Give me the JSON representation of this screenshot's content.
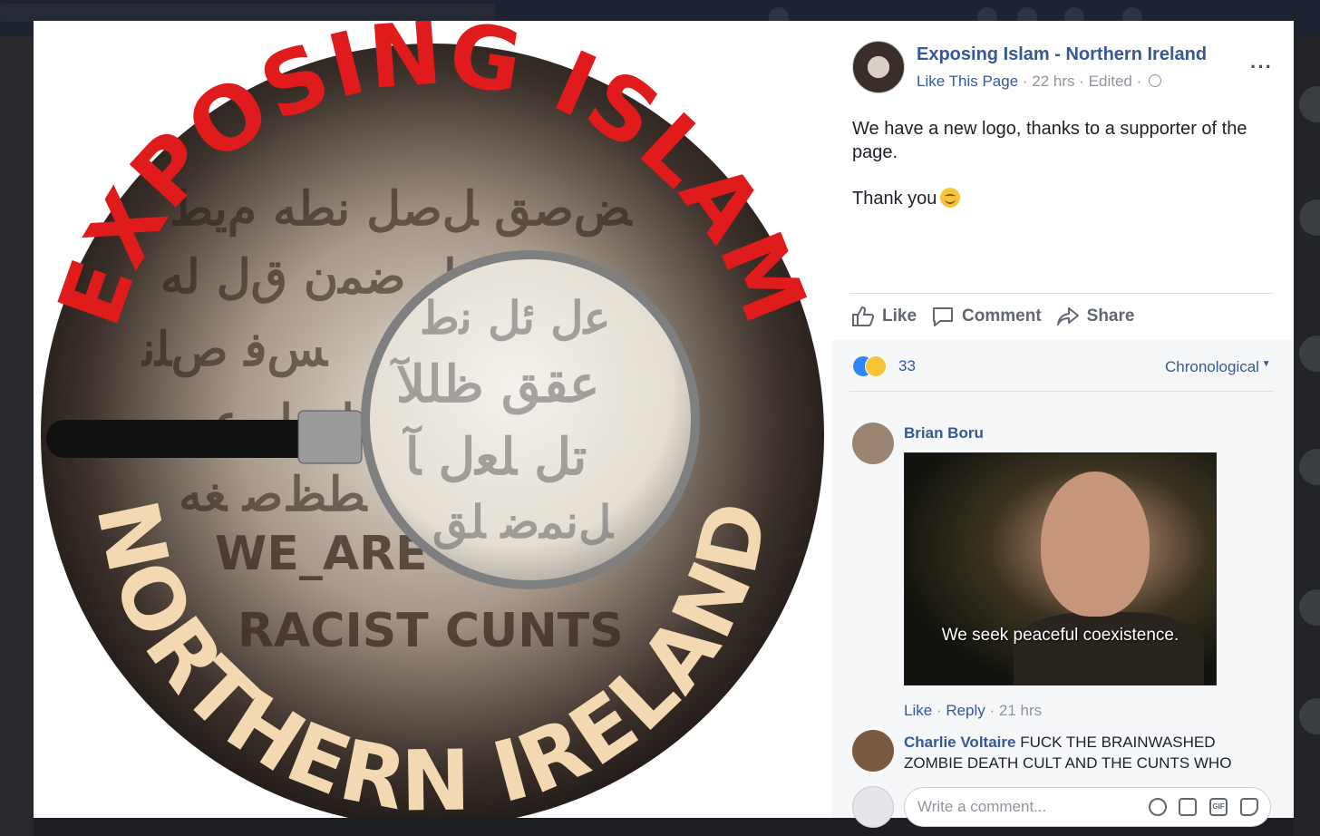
{
  "post": {
    "page_name": "Exposing Islam - Northern Ireland",
    "like_page": "Like This Page",
    "time": "22 hrs",
    "edited": "Edited",
    "text_line1": "We have a new logo, thanks to a supporter of the page.",
    "text_line2": "Thank you",
    "more_icon": "more-icon"
  },
  "actions": {
    "like": "Like",
    "comment": "Comment",
    "share": "Share"
  },
  "reactions": {
    "count": "33",
    "sort": "Chronological"
  },
  "comments": [
    {
      "author": "Brian Boru",
      "gif_caption": "We seek peaceful coexistence.",
      "like": "Like",
      "reply": "Reply",
      "time": "21 hrs"
    },
    {
      "author": "Charlie Voltaire",
      "text": "FUCK THE BRAINWASHED ZOMBIE DEATH CULT AND THE CUNTS WHO"
    }
  ],
  "composer": {
    "placeholder": "Write a comment..."
  },
  "logo": {
    "top_text": "EXPOSING ISLAM",
    "bottom_text": "NORTHERN IRELAND",
    "inner_text_1": "WE_ARE",
    "inner_text_2": "RACIST CUNTS",
    "top_color": "#e01b1b",
    "bottom_color": "#f3d9b1"
  },
  "colors": {
    "link": "#365899",
    "muted": "#90949c"
  }
}
